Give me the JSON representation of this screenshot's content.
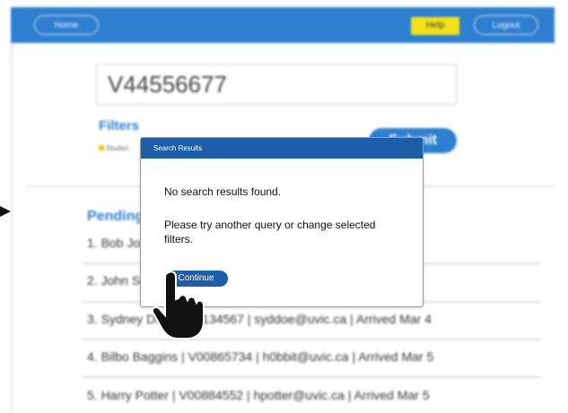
{
  "header": {
    "home_label": "Home",
    "help_label": "Help",
    "logout_label": "Logout"
  },
  "search": {
    "value": "V44556677"
  },
  "filters": {
    "label": "Filters",
    "chip_label": "Studen"
  },
  "submit_label": "Submit",
  "pending": {
    "title": "Pending",
    "rows": [
      "1. Bob Jones | V00123456 | bjones@uvic.ca | Arrived Mar 1",
      "2. John Smith | V00987654 | jsmith@uvic.ca | Arrived Mar 3",
      "3. Sydney Doe | V00134567 | syddoe@uvic.ca | Arrived Mar 4",
      "4. Bilbo Baggins | V00865734 | h0bbit@uvic.ca | Arrived Mar 5",
      "5. Harry Potter | V00884552 | hpotter@uvic.ca | Arrived Mar 5"
    ]
  },
  "modal": {
    "title": "Search Results",
    "message": "No search results found.",
    "hint": "Please try another query or change selected filters.",
    "continue_label": "Continue"
  },
  "colors": {
    "brand_blue": "#2f7fd0",
    "modal_blue": "#1e5ea8",
    "help_yellow": "#f3e21a"
  },
  "icons": {
    "pointer": "hand-pointer-icon",
    "arrow": "arrow-right-icon"
  }
}
